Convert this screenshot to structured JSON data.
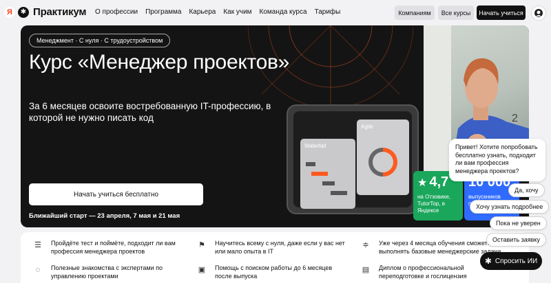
{
  "header": {
    "logo_ya": "Я",
    "logo_text": "Практикум",
    "nav": [
      "О профессии",
      "Программа",
      "Карьера",
      "Как учим",
      "Команда курса",
      "Тарифы"
    ],
    "companies_btn": "Компаниям",
    "all_courses_btn": "Все курсы",
    "start_btn": "Начать учиться"
  },
  "hero": {
    "tags": "Менеджмент · С нуля · С трудоустройством",
    "title": "Курс «Менеджер проектов»",
    "subtitle": "За 6 месяцев освоите востребованную IT-профессию, в которой не нужно писать код",
    "cta": "Начать учиться бесплатно",
    "next_start": "Ближайший старт — 23 апреля, 7 мая и 21 мая",
    "card_waterfall": "Waterfall",
    "card_agile": "Agile",
    "rating_value": "4,7",
    "rating_text": "на Отзовике, TutorTop, в Яндексе",
    "graduates_value": "10 000",
    "graduates_text": "выпускников после обучения"
  },
  "features": [
    {
      "icon": "list-icon",
      "text": "Пройдёте тест и поймёте, подходит ли вам профессия менеджера проектов"
    },
    {
      "icon": "flag-icon",
      "text": "Научитесь всему с нуля, даже если у вас нет или мало опыта в IT"
    },
    {
      "icon": "sliders-icon",
      "text": "Уже через 4 месяца обучения сможете выполнять базовые менеджерские задачи"
    },
    {
      "icon": "chat-icon",
      "text": "Полезные знакомства с экспертами по управлению проектами"
    },
    {
      "icon": "briefcase-icon",
      "text": "Помощь с поиском работы до 6 месяцев после выпуска"
    },
    {
      "icon": "diploma-icon",
      "text": "Диплом о профессиональной переподготовке и гослицензия"
    }
  ],
  "chat": {
    "message": "Привет! Хотите попробовать бесплатно узнать, подходит ли вам профессия менеджера проектов?",
    "chips": [
      "Да, хочу",
      "Хочу узнать подробнее",
      "Пока не уверен",
      "Оставить заявку"
    ],
    "ask_ai": "Спросить ИИ"
  },
  "colors": {
    "accent_green": "#1aa65b",
    "accent_blue": "#2f6bff",
    "accent_orange": "#ff5a1f"
  }
}
